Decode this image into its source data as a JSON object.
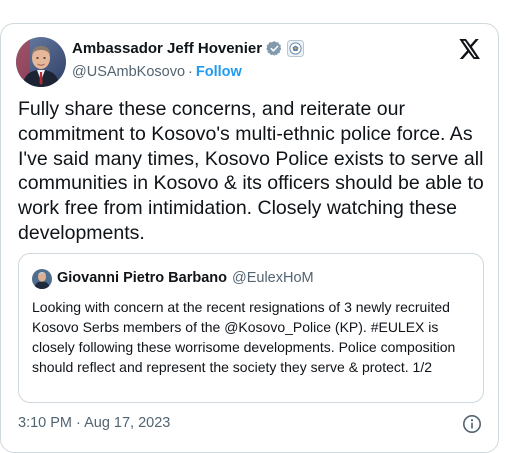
{
  "author": {
    "display_name": "Ambassador Jeff Hovenier",
    "handle": "@USAmbKosovo",
    "separator": "·",
    "follow_label": "Follow",
    "verified_badge": "verified-check-icon",
    "affiliation_badge": "state-department-seal-icon"
  },
  "tweet": {
    "text": "Fully share these concerns, and reiterate our commitment to Kosovo's multi-ethnic police force. As I've said many times, Kosovo Police exists to serve all communities in Kosovo & its officers should be able to work free from intimidation. Closely watching these developments."
  },
  "quoted_tweet": {
    "display_name": "Giovanni Pietro Barbano",
    "handle": "@EulexHoM",
    "text": "Looking with concern at the recent resignations of 3 newly recruited Kosovo Serbs members of the @Kosovo_Police (KP). #EULEX is closely following these worrisome developments. Police composition should reflect and represent the society they serve & protect. 1/2"
  },
  "footer": {
    "timestamp": "3:10 PM · Aug 17, 2023",
    "info_icon": "info-icon"
  },
  "colors": {
    "text": "#0f1419",
    "muted": "#536471",
    "accent": "#1d9bf0",
    "border": "#cfd9de"
  }
}
